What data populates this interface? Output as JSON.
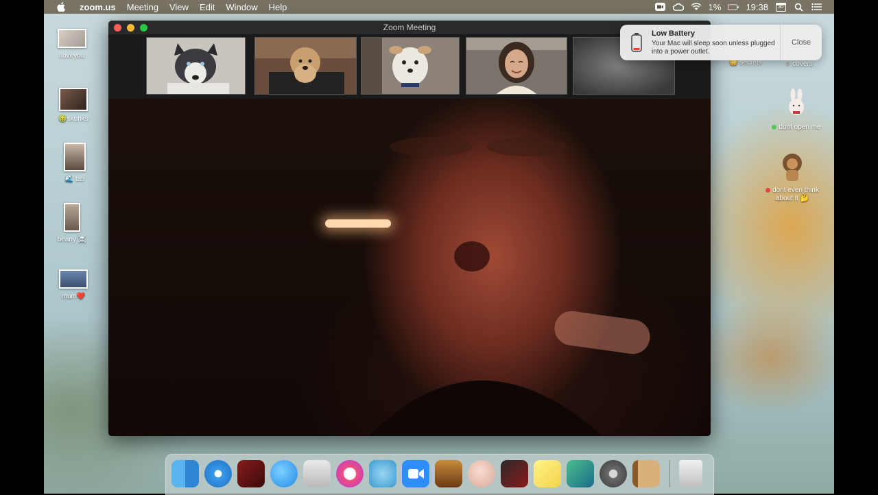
{
  "menubar": {
    "app_name": "zoom.us",
    "items": [
      "Meeting",
      "View",
      "Edit",
      "Window",
      "Help"
    ],
    "battery_percent": "1%",
    "time": "19:38",
    "calendar_day": "30"
  },
  "desktop_left": [
    {
      "label": "iloveyou"
    },
    {
      "label": "🤢skunks"
    },
    {
      "label": "🌊 tati"
    },
    {
      "label": "beany ☠️"
    },
    {
      "label": "mum❤️"
    }
  ],
  "desktop_right": [
    {
      "label": "😳 secrets"
    },
    {
      "label": "covers"
    },
    {
      "label": "dont open me"
    },
    {
      "label": "dont even think about it 🤔"
    }
  ],
  "zoom": {
    "window_title": "Zoom Meeting"
  },
  "notification": {
    "title": "Low Battery",
    "body": "Your Mac will sleep soon unless plugged into a power outlet.",
    "close_label": "Close"
  },
  "dock": {
    "apps": [
      "finder-icon",
      "safari-icon",
      "photo-booth-icon",
      "messages-icon",
      "app-store-icon",
      "music-icon",
      "preview-icon",
      "zoom-icon",
      "garageband-icon",
      "memoji-icon",
      "photo-app-icon",
      "stickies-icon",
      "preview-app-icon",
      "system-preferences-icon",
      "contacts-icon",
      "trash-icon"
    ]
  },
  "colors": {
    "accent_red": "#fe5f57",
    "accent_yellow": "#febc2e",
    "accent_green": "#28c840",
    "zoom_blue": "#2d8cff"
  }
}
